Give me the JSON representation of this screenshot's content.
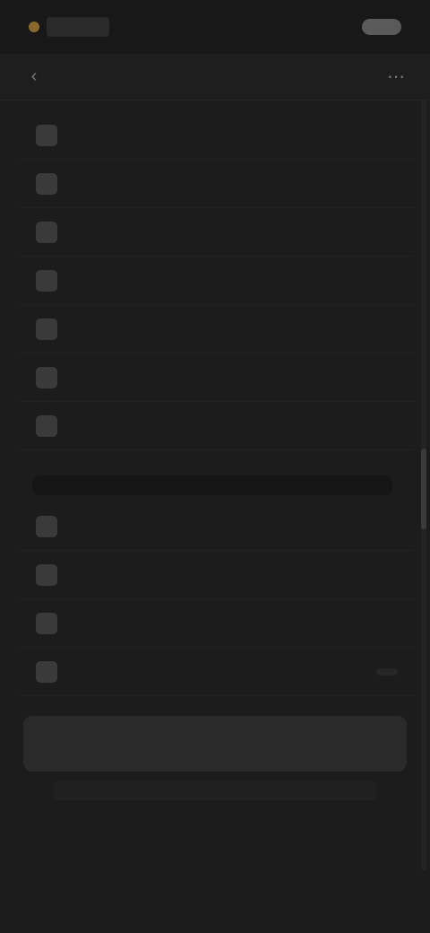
{
  "status_bar": {
    "brand": "",
    "right_text": ""
  },
  "toolbar": {
    "title": "",
    "back_icon": "chevron-left-icon",
    "menu_icon": "more-icon"
  },
  "list_a": {
    "items": [
      {
        "label": "",
        "icon": "item-icon"
      },
      {
        "label": "",
        "icon": "item-icon"
      },
      {
        "label": "",
        "icon": "item-icon"
      },
      {
        "label": "",
        "icon": "item-icon"
      },
      {
        "label": "",
        "icon": "item-icon"
      },
      {
        "label": "",
        "icon": "item-icon"
      },
      {
        "label": "",
        "icon": "item-icon"
      }
    ]
  },
  "list_b": {
    "items": [
      {
        "label": "",
        "icon": "item-icon"
      },
      {
        "label": "",
        "icon": "item-icon"
      },
      {
        "label": "",
        "icon": "item-icon"
      },
      {
        "label": "",
        "icon": "item-icon",
        "value": ""
      }
    ]
  },
  "action": {
    "label": ""
  },
  "colors": {
    "background": "#1c1c1c",
    "accent": "#8a6a2a",
    "text": "#d8d8d8"
  }
}
